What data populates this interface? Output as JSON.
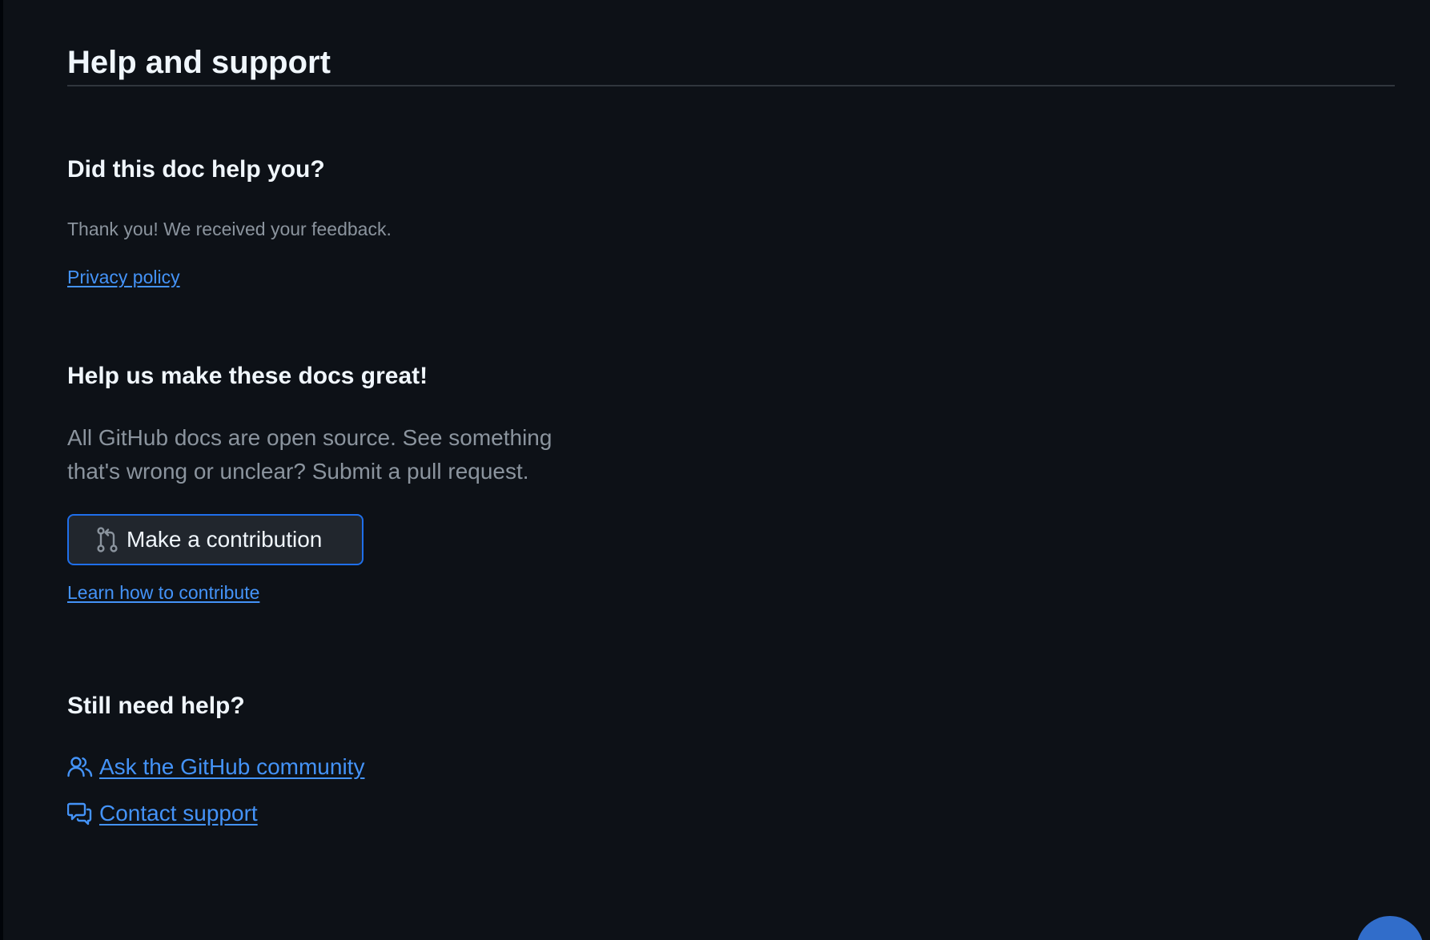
{
  "header": {
    "title": "Help and support"
  },
  "feedback": {
    "heading": "Did this doc help you?",
    "message": "Thank you! We received your feedback.",
    "privacy_link": "Privacy policy"
  },
  "contribute": {
    "heading": "Help us make these docs great!",
    "description_line1": "All GitHub docs are open source. See something",
    "description_line2": "that's wrong or unclear? Submit a pull request.",
    "button_label": "Make a contribution",
    "button_icon": "git-pull-request-icon",
    "learn_link": "Learn how to contribute"
  },
  "still_need_help": {
    "heading": "Still need help?",
    "community_link": "Ask the GitHub community",
    "community_icon": "people-icon",
    "support_link": "Contact support",
    "support_icon": "comment-discussion-icon"
  },
  "colors": {
    "background": "#0d1117",
    "link": "#4493f8",
    "button_border": "#1f6feb",
    "muted_text": "#8b949e",
    "fab": "#316dca"
  }
}
